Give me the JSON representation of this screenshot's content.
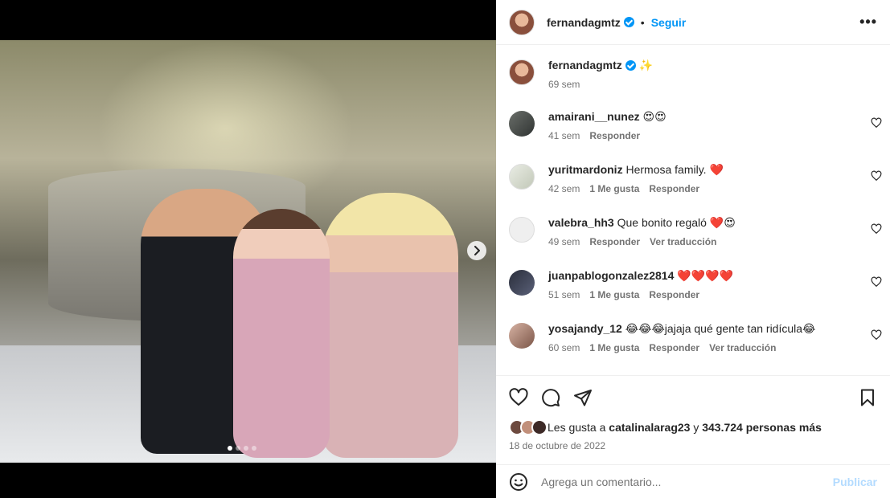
{
  "post": {
    "author": "fernandagmtz",
    "follow_label": "Seguir",
    "separator": "•",
    "more_label": "•••"
  },
  "media": {
    "slide_count": 4,
    "active_slide": 1,
    "next_label": "›"
  },
  "caption": {
    "username": "fernandagmtz",
    "text": "✨",
    "time": "69 sem"
  },
  "comments": [
    {
      "username": "amairani__nunez",
      "text": "😍😍",
      "time": "41 sem",
      "likes": "",
      "reply": "Responder",
      "translate": ""
    },
    {
      "username": "yuritmardoniz",
      "text": "Hermosa family. ❤️",
      "time": "42 sem",
      "likes": "1 Me gusta",
      "reply": "Responder",
      "translate": ""
    },
    {
      "username": "valebra_hh3",
      "text": "Que bonito regaló ❤️😍",
      "time": "49 sem",
      "likes": "",
      "reply": "Responder",
      "translate": "Ver traducción"
    },
    {
      "username": "juanpablogonzalez2814",
      "text": "❤️❤️❤️❤️",
      "time": "51 sem",
      "likes": "1 Me gusta",
      "reply": "Responder",
      "translate": ""
    },
    {
      "username": "yosajandy_12",
      "text": "😂😂😂jajaja qué gente tan ridícula😂",
      "time": "60 sem",
      "likes": "1 Me gusta",
      "reply": "Responder",
      "translate": "Ver traducción"
    }
  ],
  "likes": {
    "prefix": "Les gusta a",
    "first_user": "catalinalarag23",
    "joiner": "y",
    "others": "343.724 personas más"
  },
  "date": "18 de octubre de 2022",
  "composer": {
    "placeholder": "Agrega un comentario...",
    "publish_label": "Publicar"
  },
  "icons": [
    "heart-icon",
    "comment-icon",
    "share-icon",
    "bookmark-icon",
    "emoji-icon",
    "chevron-right-icon",
    "verified-icon",
    "more-icon"
  ],
  "colors": {
    "accent": "#0095f6",
    "muted": "#737373",
    "publish_disabled": "#b3dbff"
  }
}
